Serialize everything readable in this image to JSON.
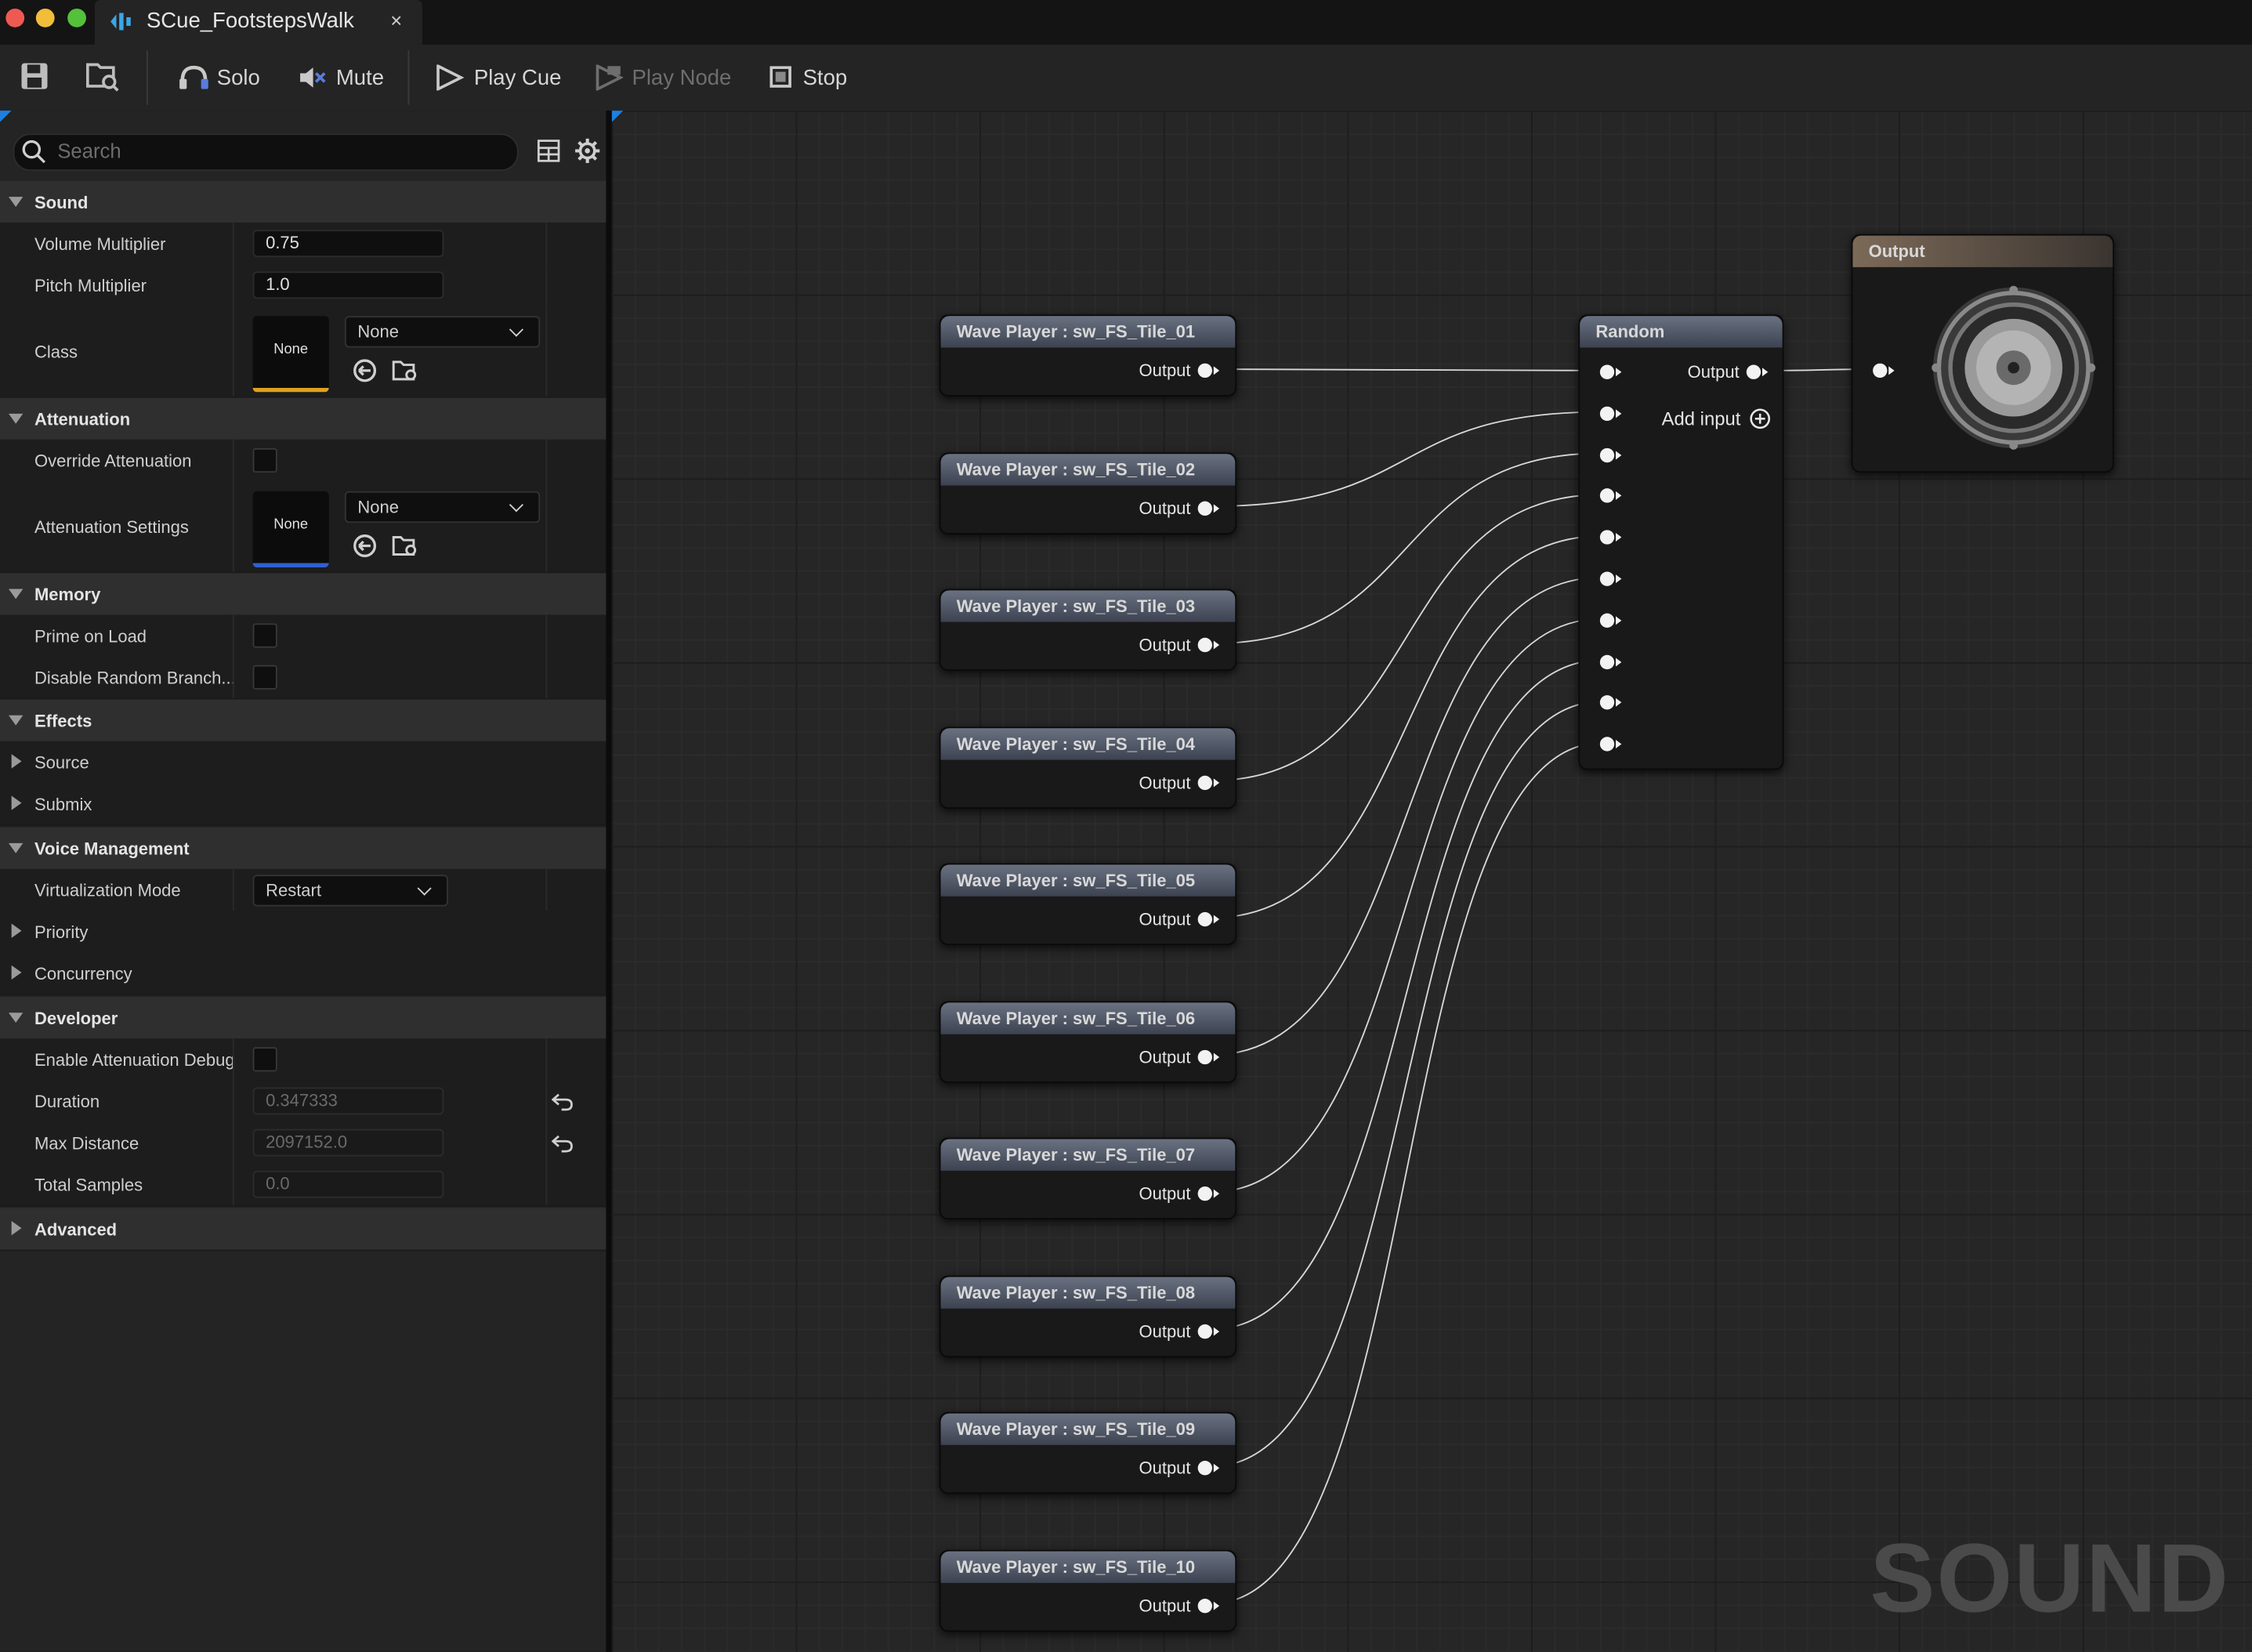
{
  "window": {
    "tab_title": "SCue_FootstepsWalk",
    "tab_close": "×"
  },
  "toolbar": {
    "solo": "Solo",
    "mute": "Mute",
    "play_cue": "Play Cue",
    "play_node": "Play Node",
    "stop": "Stop"
  },
  "details": {
    "search_placeholder": "Search",
    "sound": {
      "header": "Sound",
      "volume_label": "Volume Multiplier",
      "volume_value": "0.75",
      "pitch_label": "Pitch Multiplier",
      "pitch_value": "1.0",
      "class_label": "Class",
      "class_thumb": "None",
      "class_value": "None"
    },
    "attenuation": {
      "header": "Attenuation",
      "override_label": "Override Attenuation",
      "settings_label": "Attenuation Settings",
      "settings_thumb": "None",
      "settings_value": "None"
    },
    "memory": {
      "header": "Memory",
      "prime_label": "Prime on Load",
      "disable_random_label": "Disable Random Branch..."
    },
    "effects": {
      "header": "Effects",
      "source": "Source",
      "submix": "Submix"
    },
    "voice": {
      "header": "Voice Management",
      "virtualization_label": "Virtualization Mode",
      "virtualization_value": "Restart",
      "priority": "Priority",
      "concurrency": "Concurrency"
    },
    "developer": {
      "header": "Developer",
      "debug_label": "Enable Attenuation Debug",
      "duration_label": "Duration",
      "duration_value": "0.347333",
      "maxdist_label": "Max Distance",
      "maxdist_value": "2097152.0",
      "samples_label": "Total Samples",
      "samples_value": "0.0"
    },
    "advanced": "Advanced"
  },
  "graph": {
    "wave_nodes": [
      {
        "title": "Wave Player : sw_FS_Tile_01",
        "output": "Output"
      },
      {
        "title": "Wave Player : sw_FS_Tile_02",
        "output": "Output"
      },
      {
        "title": "Wave Player : sw_FS_Tile_03",
        "output": "Output"
      },
      {
        "title": "Wave Player : sw_FS_Tile_04",
        "output": "Output"
      },
      {
        "title": "Wave Player : sw_FS_Tile_05",
        "output": "Output"
      },
      {
        "title": "Wave Player : sw_FS_Tile_06",
        "output": "Output"
      },
      {
        "title": "Wave Player : sw_FS_Tile_07",
        "output": "Output"
      },
      {
        "title": "Wave Player : sw_FS_Tile_08",
        "output": "Output"
      },
      {
        "title": "Wave Player : sw_FS_Tile_09",
        "output": "Output"
      },
      {
        "title": "Wave Player : sw_FS_Tile_10",
        "output": "Output"
      }
    ],
    "random_node": {
      "title": "Random",
      "output": "Output",
      "add_input": "Add input",
      "input_count": 10
    },
    "output_node": {
      "title": "Output"
    },
    "watermark": "SOUND CUE",
    "wire_color": "#d8d8d8",
    "accent": "#1e7fe0"
  }
}
